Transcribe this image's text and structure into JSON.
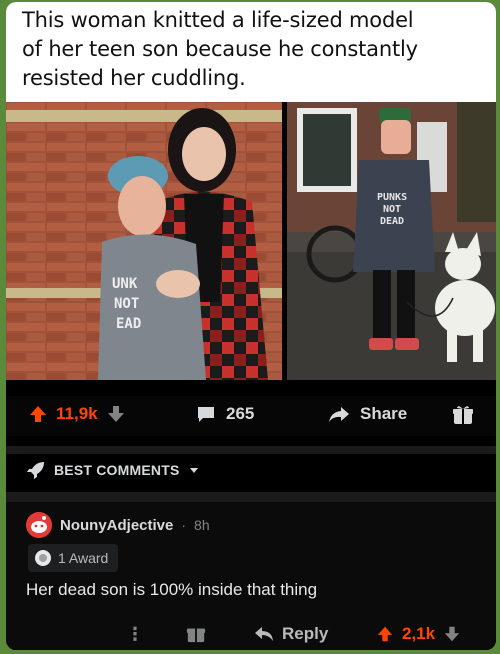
{
  "caption": {
    "line1": "This woman knitted a life-sized model",
    "line2": "of her teen son because he constantly",
    "line3": "resisted her cuddling."
  },
  "photos": {
    "left": {
      "sweater_text": [
        "UNK",
        "NOT",
        "EAD"
      ]
    },
    "right": {
      "sweater_text": [
        "PUNKS",
        "NOT",
        "DEAD"
      ]
    }
  },
  "post_actions": {
    "score": "11,9k",
    "comments": "265",
    "share_label": "Share"
  },
  "sort": {
    "label": "BEST COMMENTS"
  },
  "comment": {
    "username": "NounyAdjective",
    "separator": "·",
    "age": "8h",
    "award_label": "1 Award",
    "body": "Her dead son is 100% inside that thing",
    "more": "⋮",
    "reply_label": "Reply",
    "score": "2,1k"
  },
  "colors": {
    "upvote": "#ff4500",
    "text": "#d7dadc",
    "muted": "#818384",
    "background": "#000000",
    "caption_bg": "#ffffff"
  },
  "icons": [
    "upvote-icon",
    "downvote-icon",
    "comment-icon",
    "share-icon",
    "award-icon",
    "rocket-icon",
    "chevron-down-icon",
    "avatar-icon",
    "reply-icon",
    "more-icon"
  ]
}
